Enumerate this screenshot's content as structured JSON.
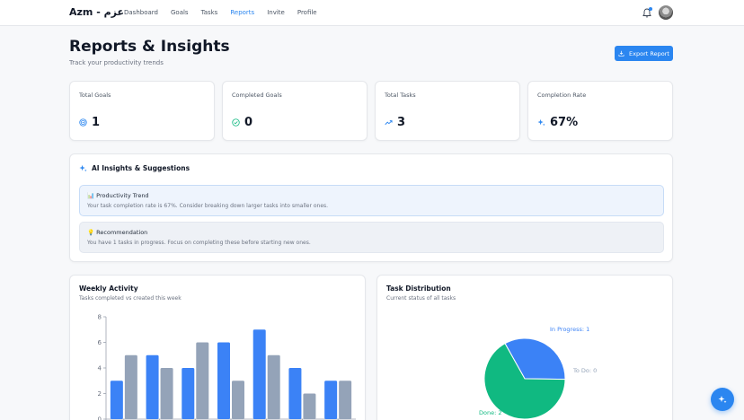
{
  "brand": "Azm - عزم",
  "nav": [
    {
      "label": "Dashboard",
      "active": false
    },
    {
      "label": "Goals",
      "active": false
    },
    {
      "label": "Tasks",
      "active": false
    },
    {
      "label": "Reports",
      "active": true
    },
    {
      "label": "Invite",
      "active": false
    },
    {
      "label": "Profile",
      "active": false
    }
  ],
  "header": {
    "title": "Reports & Insights",
    "subtitle": "Track your productivity trends",
    "export_label": "Export Report"
  },
  "stats": [
    {
      "label": "Total Goals",
      "value": "1",
      "icon": "target-icon",
      "color": "#2b86f0"
    },
    {
      "label": "Completed Goals",
      "value": "0",
      "icon": "check-circle-icon",
      "color": "#10b981"
    },
    {
      "label": "Total Tasks",
      "value": "3",
      "icon": "trending-up-icon",
      "color": "#2b86f0"
    },
    {
      "label": "Completion Rate",
      "value": "67%",
      "icon": "sparkles-icon",
      "color": "#2b86f0"
    }
  ],
  "ai": {
    "title": "AI Insights & Suggestions",
    "insights": [
      {
        "icon": "📊",
        "title": "Productivity Trend",
        "text": "Your task completion rate is 67%. Consider breaking down larger tasks into smaller ones."
      },
      {
        "icon": "💡",
        "title": "Recommendation",
        "text": "You have 1 tasks in progress. Focus on completing these before starting new ones."
      }
    ]
  },
  "weekly": {
    "title": "Weekly Activity",
    "subtitle": "Tasks completed vs created this week"
  },
  "distribution": {
    "title": "Task Distribution",
    "subtitle": "Current status of all tasks"
  },
  "chart_data": [
    {
      "type": "bar",
      "categories": [
        "",
        "",
        "",
        "",
        "",
        "",
        ""
      ],
      "series": [
        {
          "values": [
            3,
            5,
            4,
            6,
            7,
            4,
            3
          ],
          "color": "#3b82f6"
        },
        {
          "values": [
            5,
            4,
            6,
            3,
            5,
            2,
            3
          ],
          "color": "#94a3b8"
        }
      ],
      "ylim": [
        0,
        8
      ],
      "yticks": [
        0,
        2,
        4,
        6,
        8
      ],
      "grid": false
    },
    {
      "type": "pie",
      "labels": [
        "In Progress: 1",
        "To Do: 0",
        "Done: 2"
      ],
      "values": [
        1,
        0,
        2
      ],
      "colors": [
        "#3b82f6",
        "#94a3b8",
        "#10b981"
      ],
      "label_colors": [
        "#3b82f6",
        "#94a3b8",
        "#10b981"
      ]
    }
  ],
  "colors": {
    "accent": "#2b86f0",
    "success": "#10b981"
  }
}
